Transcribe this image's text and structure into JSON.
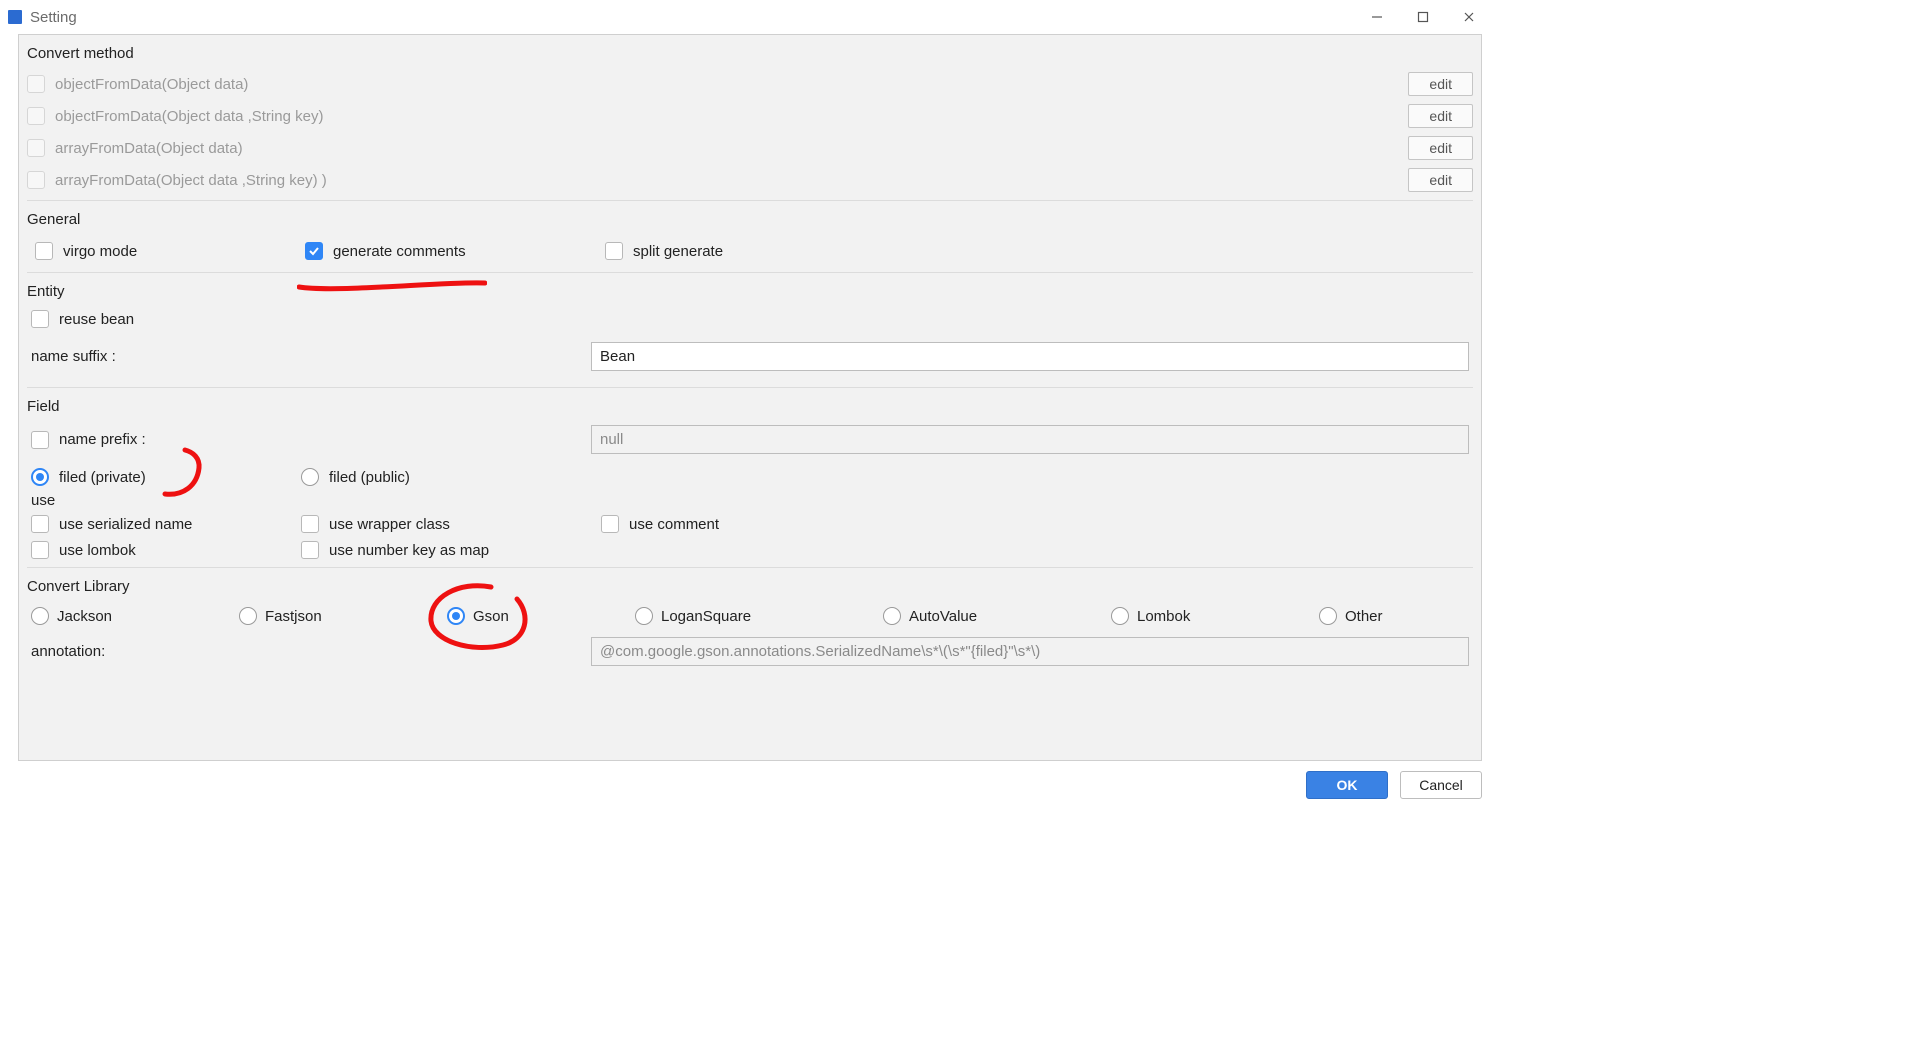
{
  "window": {
    "title": "Setting",
    "minimize_tooltip": "Minimize",
    "maximize_tooltip": "Maximize",
    "close_tooltip": "Close"
  },
  "sections": {
    "convert_method_title": "Convert method",
    "general_title": "General",
    "entity_title": "Entity",
    "field_title": "Field",
    "use_title": "use",
    "convert_library_title": "Convert Library"
  },
  "methods": [
    {
      "label": "objectFromData(Object data)",
      "checked": false,
      "enabled": false,
      "edit": "edit"
    },
    {
      "label": "objectFromData(Object data ,String key)",
      "checked": false,
      "enabled": false,
      "edit": "edit"
    },
    {
      "label": "arrayFromData(Object data)",
      "checked": false,
      "enabled": false,
      "edit": "edit"
    },
    {
      "label": "arrayFromData(Object data ,String key) )",
      "checked": false,
      "enabled": false,
      "edit": "edit"
    }
  ],
  "general": {
    "virgo_mode": {
      "label": "virgo mode",
      "checked": false
    },
    "generate_comments": {
      "label": "generate comments",
      "checked": true
    },
    "split_generate": {
      "label": "split generate",
      "checked": false
    }
  },
  "entity": {
    "reuse_bean": {
      "label": "reuse bean",
      "checked": false
    },
    "name_suffix_label": "name suffix :",
    "name_suffix_value": "Bean"
  },
  "field": {
    "name_prefix": {
      "label": "name prefix :",
      "checked": false
    },
    "name_prefix_value": "null",
    "scope": {
      "private_label": "filed (private)",
      "public_label": "filed (public)",
      "selected": "private"
    },
    "use_serialized_name": {
      "label": "use serialized name",
      "checked": false
    },
    "use_wrapper_class": {
      "label": "use wrapper class",
      "checked": false
    },
    "use_comment": {
      "label": "use comment",
      "checked": false
    },
    "use_lombok": {
      "label": "use lombok",
      "checked": false
    },
    "use_number_key_as_map": {
      "label": "use number key as map",
      "checked": false
    }
  },
  "library": {
    "options": [
      {
        "key": "jackson",
        "label": "Jackson"
      },
      {
        "key": "fastjson",
        "label": "Fastjson"
      },
      {
        "key": "gson",
        "label": "Gson"
      },
      {
        "key": "logansquare",
        "label": "LoganSquare"
      },
      {
        "key": "autovalue",
        "label": "AutoValue"
      },
      {
        "key": "lombok",
        "label": "Lombok"
      },
      {
        "key": "other",
        "label": "Other"
      }
    ],
    "selected": "gson",
    "annotation_label": "annotation:",
    "annotation_value": "@com.google.gson.annotations.SerializedName\\s*\\(\\s*\"{filed}\"\\s*\\)"
  },
  "footer": {
    "ok": "OK",
    "cancel": "Cancel"
  }
}
